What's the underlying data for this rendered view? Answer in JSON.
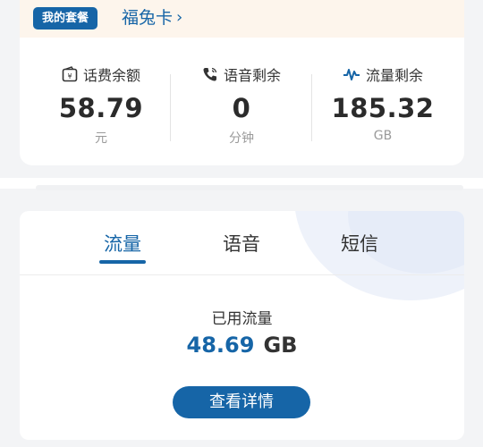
{
  "plan": {
    "badge": "我的套餐",
    "name": "福兔卡",
    "chevron": "›"
  },
  "stats": [
    {
      "label": "话费余额",
      "value": "58.79",
      "unit": "元",
      "icon": "wallet-yuan-icon"
    },
    {
      "label": "语音剩余",
      "value": "0",
      "unit": "分钟",
      "icon": "phone-icon"
    },
    {
      "label": "流量剩余",
      "value": "185.32",
      "unit": "GB",
      "icon": "signal-wave-icon"
    }
  ],
  "tabs": [
    {
      "label": "流量",
      "active": true
    },
    {
      "label": "语音",
      "active": false
    },
    {
      "label": "短信",
      "active": false
    }
  ],
  "usage": {
    "label": "已用流量",
    "value": "48.69",
    "unit": "GB"
  },
  "detail_button": "查看详情",
  "colors": {
    "accent": "#1665a7",
    "plan_strip_bg": "#fdf5ec",
    "page_bg": "#f3f4f6"
  }
}
